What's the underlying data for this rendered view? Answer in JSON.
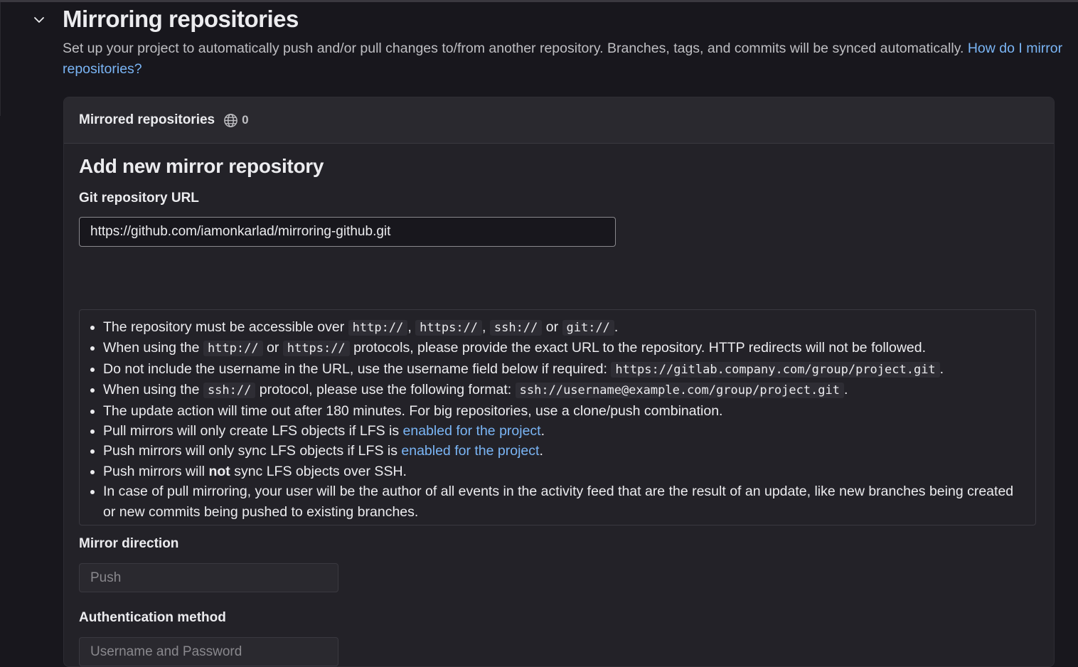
{
  "section": {
    "title": "Mirroring repositories",
    "description": "Set up your project to automatically push and/or pull changes to/from another repository. Branches, tags, and commits will be synced automatically.",
    "help_link": "How do I mirror repositories?"
  },
  "card": {
    "header_title": "Mirrored repositories",
    "mirror_count": "0"
  },
  "form": {
    "title": "Add new mirror repository",
    "url_label": "Git repository URL",
    "url_value": "https://github.com/iamonkarlad/mirroring-github.git",
    "help": {
      "item1_a": "The repository must be accessible over",
      "item1_code1": "http://",
      "item1_sep1": ",",
      "item1_code2": "https://",
      "item1_sep2": ",",
      "item1_code3": "ssh://",
      "item1_or": "or",
      "item1_code4": "git://",
      "item1_end": ".",
      "item2_a": "When using the",
      "item2_code1": "http://",
      "item2_or": "or",
      "item2_code2": "https://",
      "item2_b": "protocols, please provide the exact URL to the repository. HTTP redirects will not be followed.",
      "item3_a": "Do not include the username in the URL, use the username field below if required:",
      "item3_code": "https://gitlab.company.com/group/project.git",
      "item3_end": ".",
      "item4_a": "When using the",
      "item4_code1": "ssh://",
      "item4_b": "protocol, please use the following format:",
      "item4_code2": "ssh://username@example.com/group/project.git",
      "item4_end": ".",
      "item5": "The update action will time out after 180 minutes. For big repositories, use a clone/push combination.",
      "item6_a": "Pull mirrors will only create LFS objects if LFS is",
      "item6_link": "enabled for the project",
      "item6_end": ".",
      "item7_a": "Push mirrors will only sync LFS objects if LFS is",
      "item7_link": "enabled for the project",
      "item7_end": ".",
      "item8_a": "Push mirrors will",
      "item8_bold": "not",
      "item8_b": "sync LFS objects over SSH.",
      "item9": "In case of pull mirroring, your user will be the author of all events in the activity feed that are the result of an update, like new branches being created or new commits being pushed to existing branches."
    },
    "direction_label": "Mirror direction",
    "direction_value": "Push",
    "auth_label": "Authentication method",
    "auth_value": "Username and Password"
  },
  "icons": {
    "collapse": "chevron-down-icon",
    "globe": "globe-icon"
  }
}
